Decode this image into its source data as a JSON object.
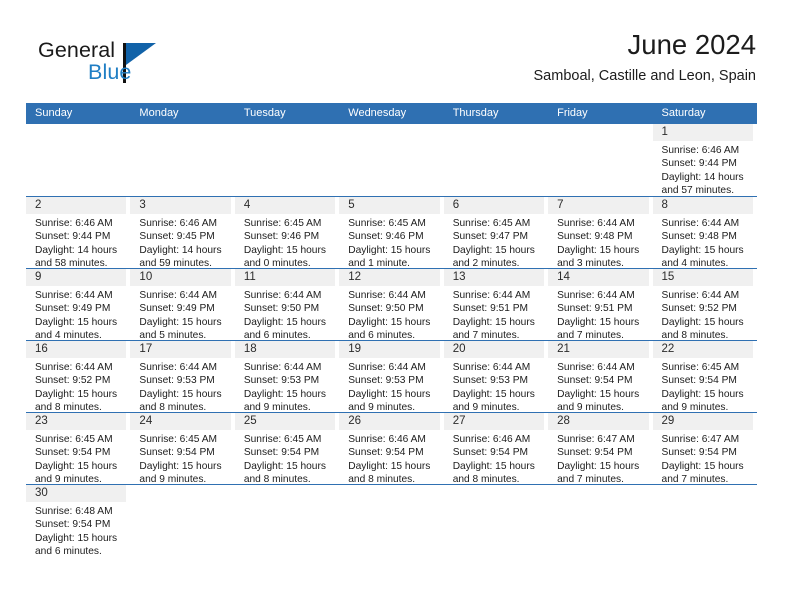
{
  "brand": {
    "name_top": "General",
    "name_bottom": "Blue",
    "accent_color": "#1f7ec4",
    "logo_mark": "triangle-flag"
  },
  "header": {
    "title": "June 2024",
    "subtitle": "Samboal, Castille and Leon, Spain"
  },
  "calendar": {
    "header_bg": "#2f70b2",
    "daynum_bg": "#f0f0f0",
    "weekdays": [
      "Sunday",
      "Monday",
      "Tuesday",
      "Wednesday",
      "Thursday",
      "Friday",
      "Saturday"
    ],
    "weeks": [
      [
        {
          "day": "",
          "lines": []
        },
        {
          "day": "",
          "lines": []
        },
        {
          "day": "",
          "lines": []
        },
        {
          "day": "",
          "lines": []
        },
        {
          "day": "",
          "lines": []
        },
        {
          "day": "",
          "lines": []
        },
        {
          "day": "1",
          "lines": [
            "Sunrise: 6:46 AM",
            "Sunset: 9:44 PM",
            "Daylight: 14 hours",
            "and 57 minutes."
          ]
        }
      ],
      [
        {
          "day": "2",
          "lines": [
            "Sunrise: 6:46 AM",
            "Sunset: 9:44 PM",
            "Daylight: 14 hours",
            "and 58 minutes."
          ]
        },
        {
          "day": "3",
          "lines": [
            "Sunrise: 6:46 AM",
            "Sunset: 9:45 PM",
            "Daylight: 14 hours",
            "and 59 minutes."
          ]
        },
        {
          "day": "4",
          "lines": [
            "Sunrise: 6:45 AM",
            "Sunset: 9:46 PM",
            "Daylight: 15 hours",
            "and 0 minutes."
          ]
        },
        {
          "day": "5",
          "lines": [
            "Sunrise: 6:45 AM",
            "Sunset: 9:46 PM",
            "Daylight: 15 hours",
            "and 1 minute."
          ]
        },
        {
          "day": "6",
          "lines": [
            "Sunrise: 6:45 AM",
            "Sunset: 9:47 PM",
            "Daylight: 15 hours",
            "and 2 minutes."
          ]
        },
        {
          "day": "7",
          "lines": [
            "Sunrise: 6:44 AM",
            "Sunset: 9:48 PM",
            "Daylight: 15 hours",
            "and 3 minutes."
          ]
        },
        {
          "day": "8",
          "lines": [
            "Sunrise: 6:44 AM",
            "Sunset: 9:48 PM",
            "Daylight: 15 hours",
            "and 4 minutes."
          ]
        }
      ],
      [
        {
          "day": "9",
          "lines": [
            "Sunrise: 6:44 AM",
            "Sunset: 9:49 PM",
            "Daylight: 15 hours",
            "and 4 minutes."
          ]
        },
        {
          "day": "10",
          "lines": [
            "Sunrise: 6:44 AM",
            "Sunset: 9:49 PM",
            "Daylight: 15 hours",
            "and 5 minutes."
          ]
        },
        {
          "day": "11",
          "lines": [
            "Sunrise: 6:44 AM",
            "Sunset: 9:50 PM",
            "Daylight: 15 hours",
            "and 6 minutes."
          ]
        },
        {
          "day": "12",
          "lines": [
            "Sunrise: 6:44 AM",
            "Sunset: 9:50 PM",
            "Daylight: 15 hours",
            "and 6 minutes."
          ]
        },
        {
          "day": "13",
          "lines": [
            "Sunrise: 6:44 AM",
            "Sunset: 9:51 PM",
            "Daylight: 15 hours",
            "and 7 minutes."
          ]
        },
        {
          "day": "14",
          "lines": [
            "Sunrise: 6:44 AM",
            "Sunset: 9:51 PM",
            "Daylight: 15 hours",
            "and 7 minutes."
          ]
        },
        {
          "day": "15",
          "lines": [
            "Sunrise: 6:44 AM",
            "Sunset: 9:52 PM",
            "Daylight: 15 hours",
            "and 8 minutes."
          ]
        }
      ],
      [
        {
          "day": "16",
          "lines": [
            "Sunrise: 6:44 AM",
            "Sunset: 9:52 PM",
            "Daylight: 15 hours",
            "and 8 minutes."
          ]
        },
        {
          "day": "17",
          "lines": [
            "Sunrise: 6:44 AM",
            "Sunset: 9:53 PM",
            "Daylight: 15 hours",
            "and 8 minutes."
          ]
        },
        {
          "day": "18",
          "lines": [
            "Sunrise: 6:44 AM",
            "Sunset: 9:53 PM",
            "Daylight: 15 hours",
            "and 9 minutes."
          ]
        },
        {
          "day": "19",
          "lines": [
            "Sunrise: 6:44 AM",
            "Sunset: 9:53 PM",
            "Daylight: 15 hours",
            "and 9 minutes."
          ]
        },
        {
          "day": "20",
          "lines": [
            "Sunrise: 6:44 AM",
            "Sunset: 9:53 PM",
            "Daylight: 15 hours",
            "and 9 minutes."
          ]
        },
        {
          "day": "21",
          "lines": [
            "Sunrise: 6:44 AM",
            "Sunset: 9:54 PM",
            "Daylight: 15 hours",
            "and 9 minutes."
          ]
        },
        {
          "day": "22",
          "lines": [
            "Sunrise: 6:45 AM",
            "Sunset: 9:54 PM",
            "Daylight: 15 hours",
            "and 9 minutes."
          ]
        }
      ],
      [
        {
          "day": "23",
          "lines": [
            "Sunrise: 6:45 AM",
            "Sunset: 9:54 PM",
            "Daylight: 15 hours",
            "and 9 minutes."
          ]
        },
        {
          "day": "24",
          "lines": [
            "Sunrise: 6:45 AM",
            "Sunset: 9:54 PM",
            "Daylight: 15 hours",
            "and 9 minutes."
          ]
        },
        {
          "day": "25",
          "lines": [
            "Sunrise: 6:45 AM",
            "Sunset: 9:54 PM",
            "Daylight: 15 hours",
            "and 8 minutes."
          ]
        },
        {
          "day": "26",
          "lines": [
            "Sunrise: 6:46 AM",
            "Sunset: 9:54 PM",
            "Daylight: 15 hours",
            "and 8 minutes."
          ]
        },
        {
          "day": "27",
          "lines": [
            "Sunrise: 6:46 AM",
            "Sunset: 9:54 PM",
            "Daylight: 15 hours",
            "and 8 minutes."
          ]
        },
        {
          "day": "28",
          "lines": [
            "Sunrise: 6:47 AM",
            "Sunset: 9:54 PM",
            "Daylight: 15 hours",
            "and 7 minutes."
          ]
        },
        {
          "day": "29",
          "lines": [
            "Sunrise: 6:47 AM",
            "Sunset: 9:54 PM",
            "Daylight: 15 hours",
            "and 7 minutes."
          ]
        }
      ],
      [
        {
          "day": "30",
          "lines": [
            "Sunrise: 6:48 AM",
            "Sunset: 9:54 PM",
            "Daylight: 15 hours",
            "and 6 minutes."
          ]
        },
        {
          "day": "",
          "lines": []
        },
        {
          "day": "",
          "lines": []
        },
        {
          "day": "",
          "lines": []
        },
        {
          "day": "",
          "lines": []
        },
        {
          "day": "",
          "lines": []
        },
        {
          "day": "",
          "lines": []
        }
      ]
    ]
  }
}
